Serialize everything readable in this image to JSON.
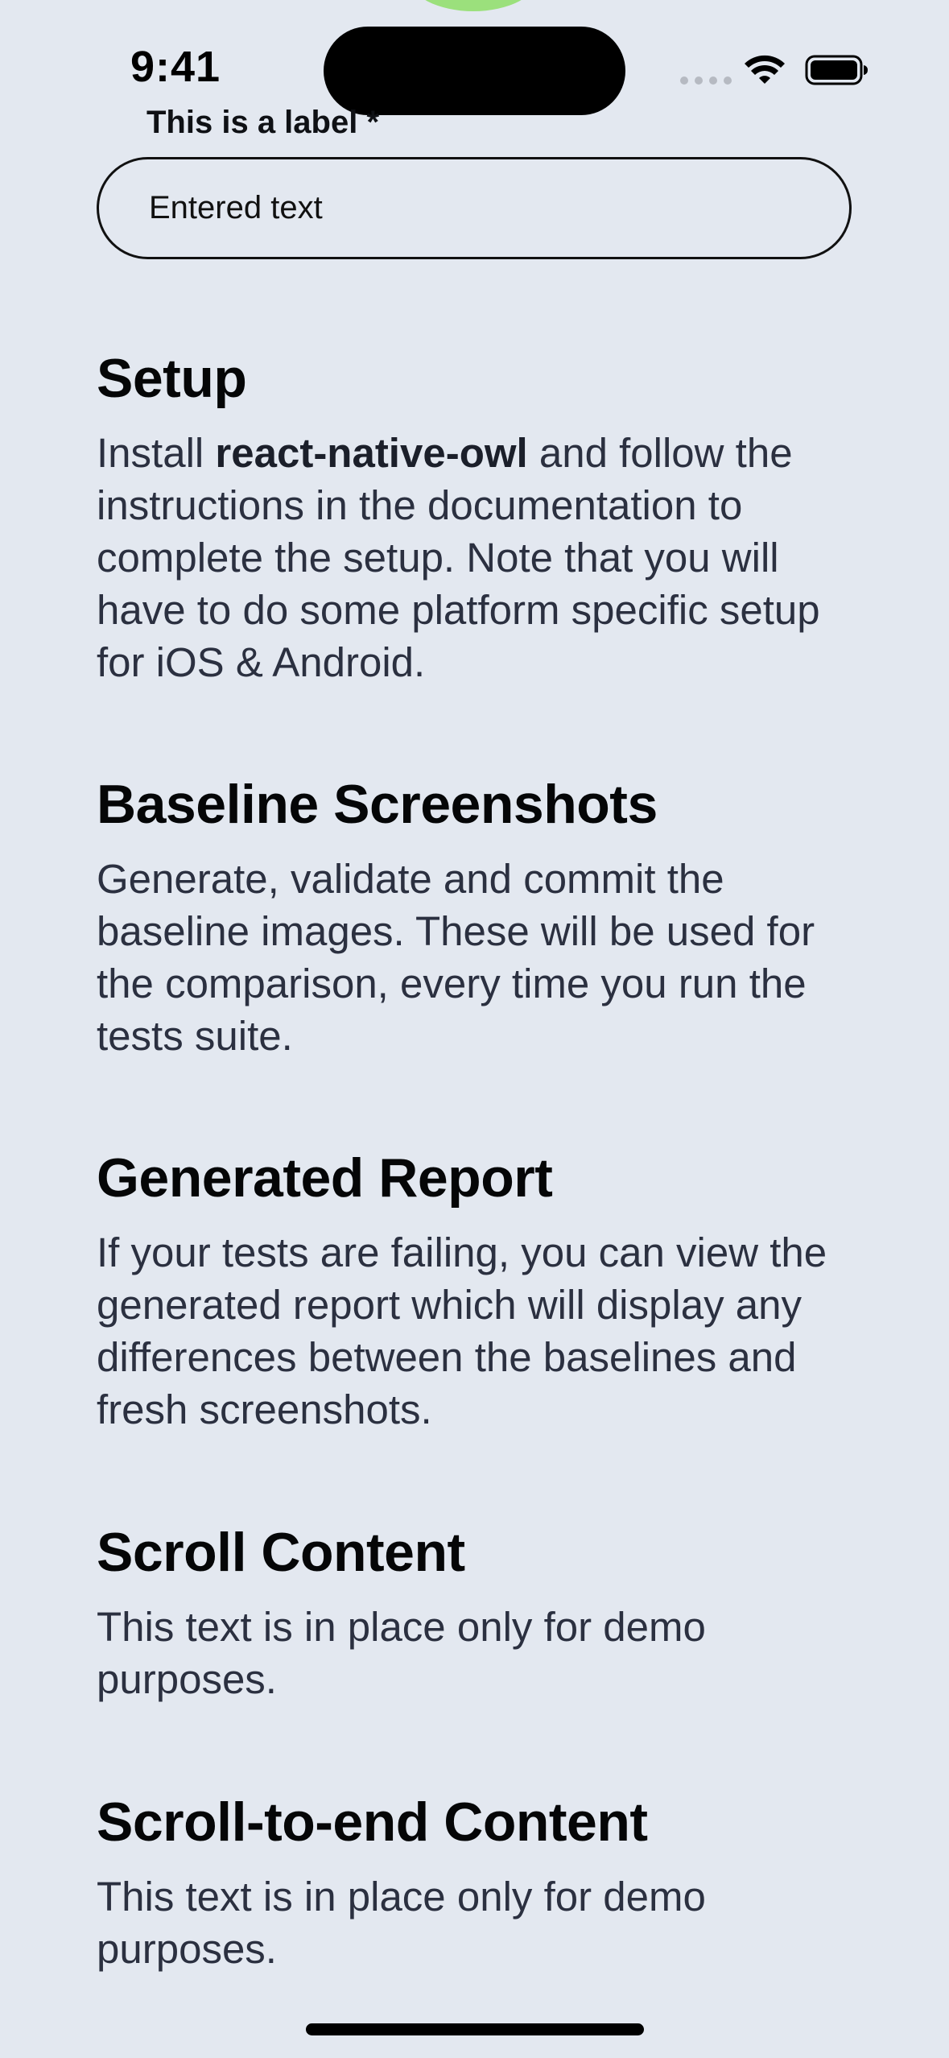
{
  "status_bar": {
    "time": "9:41"
  },
  "form": {
    "label": "This is a label *",
    "input_value": "Entered text"
  },
  "sections": [
    {
      "title": "Setup",
      "body_prefix": "Install ",
      "body_bold": "react-native-owl",
      "body_suffix": " and follow the instructions in the documentation to complete the setup. Note that you will have to do some platform specific setup for iOS & Android."
    },
    {
      "title": "Baseline Screenshots",
      "body": "Generate, validate and commit the baseline images. These will be used for the comparison, every time you run the tests suite."
    },
    {
      "title": "Generated Report",
      "body": "If your tests are failing, you can view the generated report which will display any differences between the baselines and fresh screenshots."
    },
    {
      "title": "Scroll Content",
      "body": "This text is in place only for demo purposes."
    },
    {
      "title": "Scroll-to-end Content",
      "body": "This text is in place only for demo purposes."
    }
  ],
  "icons": {
    "wifi": "wifi-icon",
    "battery": "battery-icon",
    "signal": "cellular-signal-icon"
  },
  "colors": {
    "background": "#e3e8f0",
    "heading": "#050607",
    "body_text": "#2b3040",
    "top_blob": "#9be07c"
  }
}
